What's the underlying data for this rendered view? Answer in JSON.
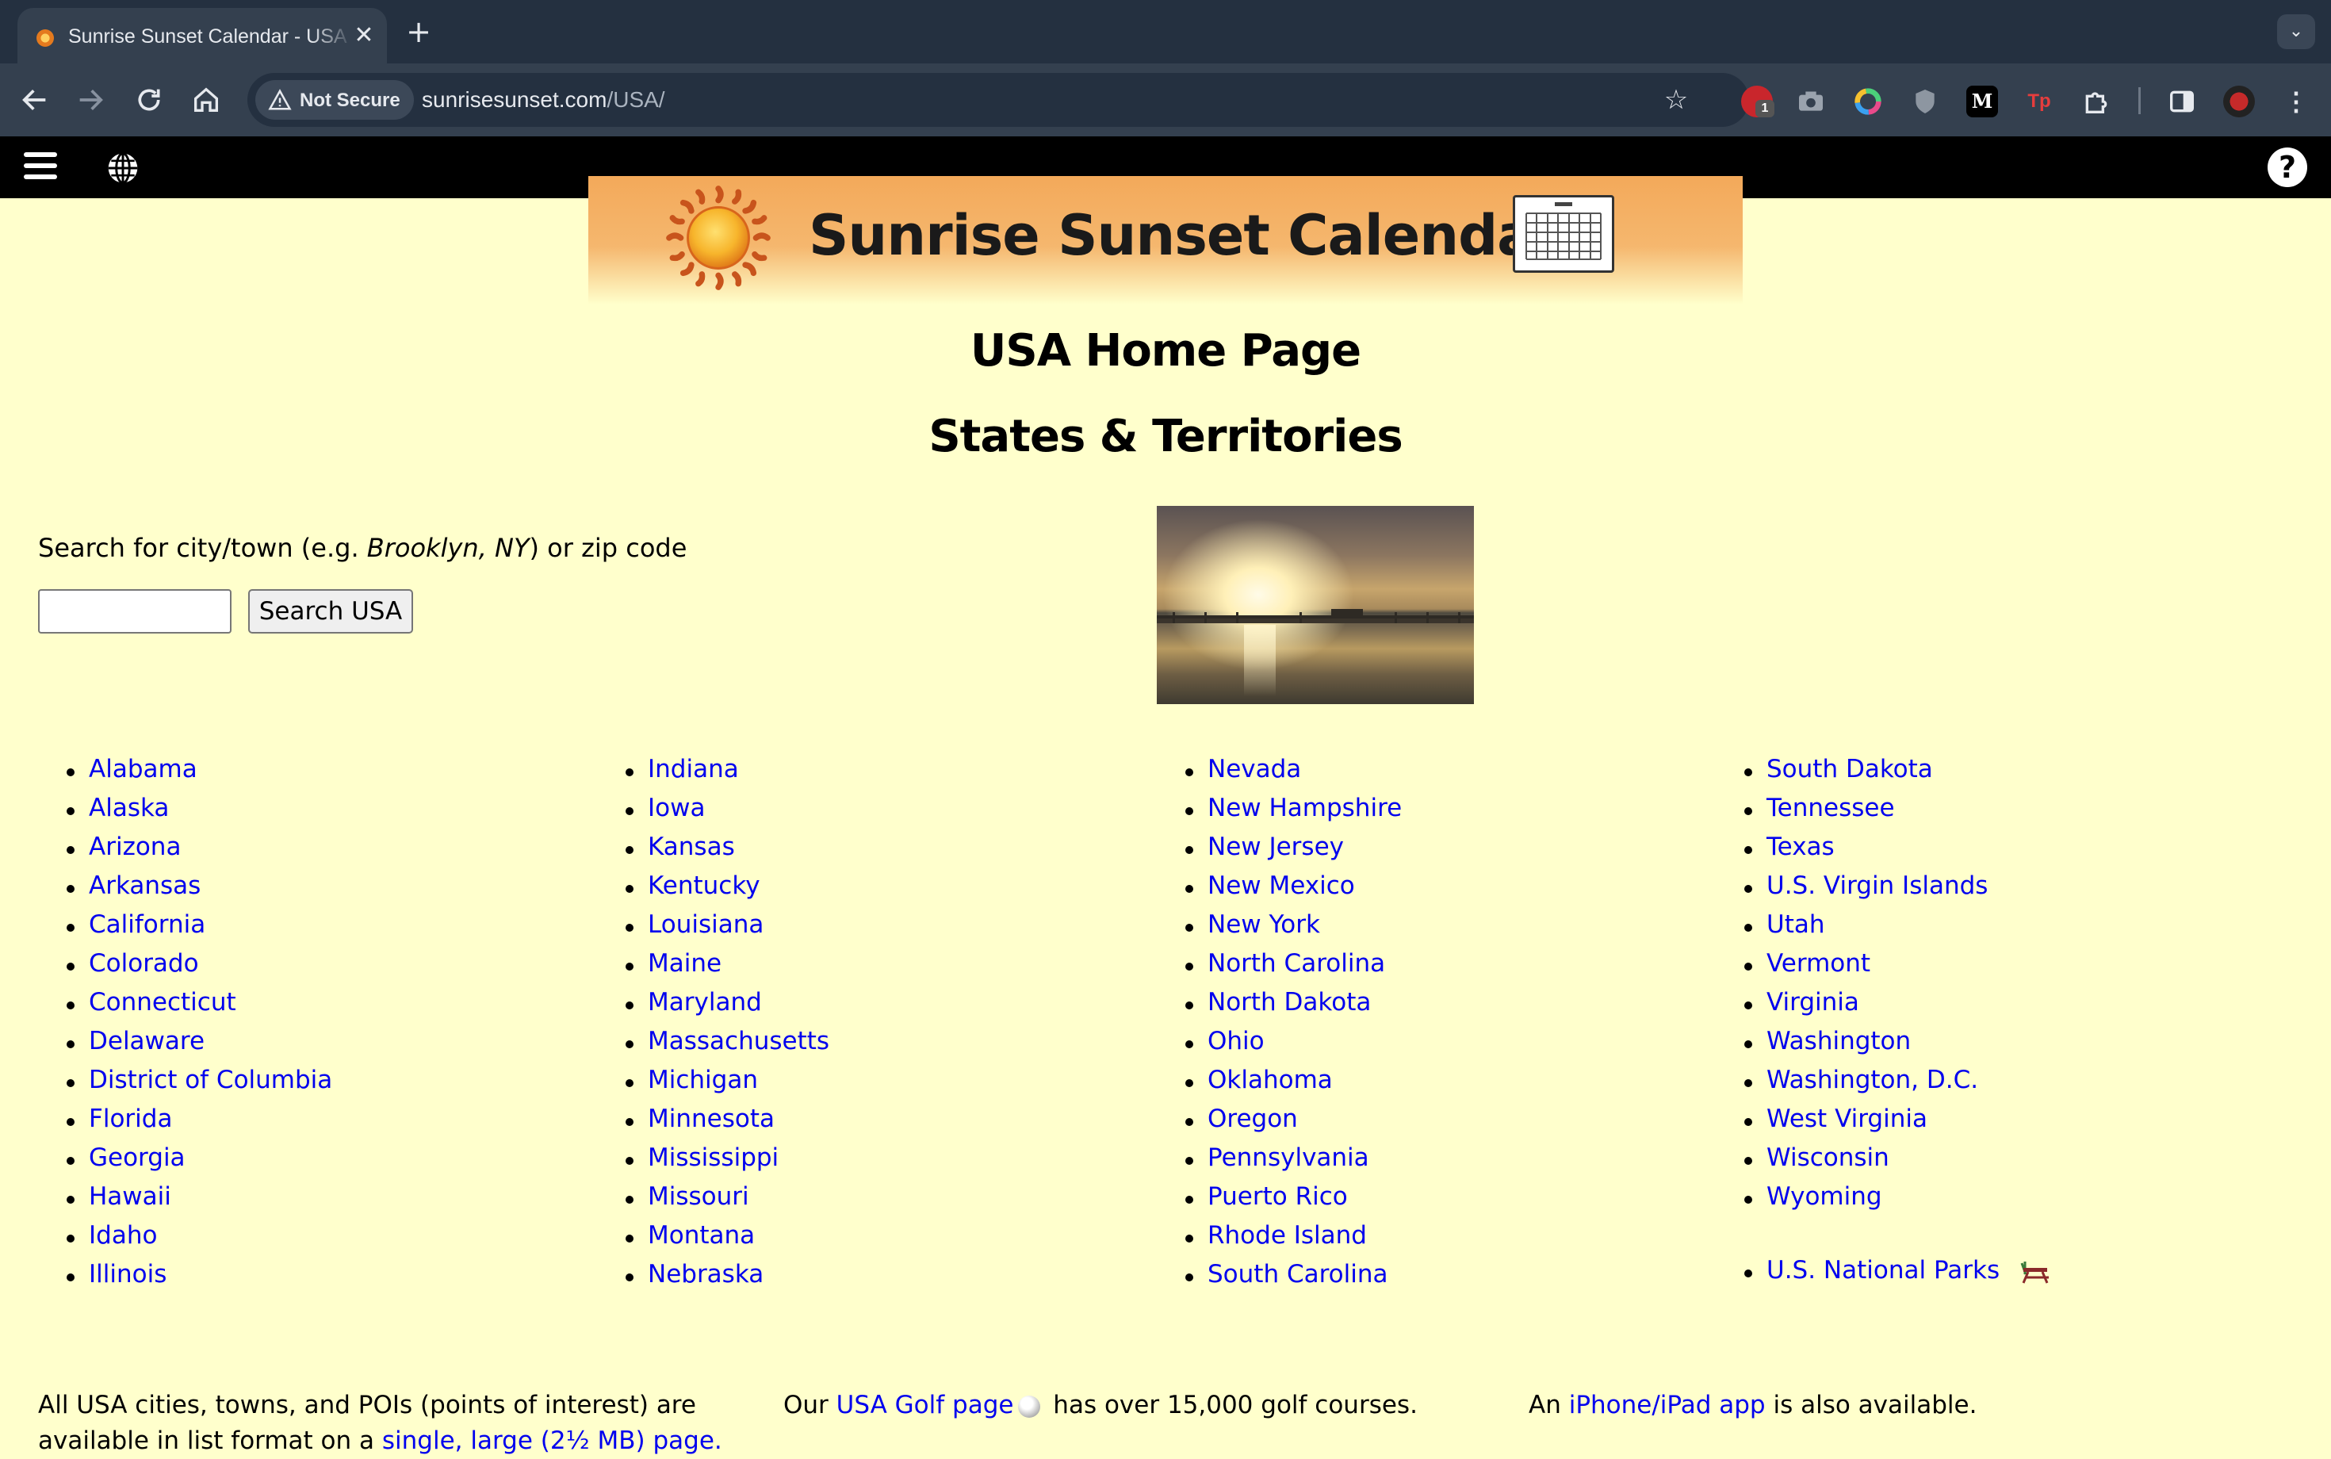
{
  "browser": {
    "tab_title": "Sunrise Sunset Calendar - USA",
    "tab_close": "✕",
    "new_tab": "+",
    "tab_menu": "⌄",
    "security_label": "Not Secure",
    "url_host": "sunrisesunset.com",
    "url_path": "/USA/",
    "extensions": [
      {
        "name": "adblock-icon",
        "glyph": "",
        "badge": "1"
      },
      {
        "name": "screenshot-icon",
        "glyph": ""
      },
      {
        "name": "color-icon",
        "glyph": ""
      },
      {
        "name": "shield-icon",
        "glyph": ""
      },
      {
        "name": "medium-icon",
        "glyph": "M"
      },
      {
        "name": "tp-icon",
        "glyph": "Tp"
      },
      {
        "name": "puzzle-icon",
        "glyph": ""
      }
    ]
  },
  "site_bar": {
    "help": "?"
  },
  "banner": {
    "title": "Sunrise Sunset Calendars"
  },
  "page": {
    "title": "USA Home Page",
    "subtitle": "States & Territories"
  },
  "search": {
    "label_prefix": "Search for city/town (e.g. ",
    "label_example": "Brooklyn, NY",
    "label_suffix": ") or zip code",
    "input_value": "",
    "button": "Search USA"
  },
  "states": {
    "col1": [
      "Alabama",
      "Alaska",
      "Arizona",
      "Arkansas",
      "California",
      "Colorado",
      "Connecticut",
      "Delaware",
      "District of Columbia",
      "Florida",
      "Georgia",
      "Hawaii",
      "Idaho",
      "Illinois"
    ],
    "col2": [
      "Indiana",
      "Iowa",
      "Kansas",
      "Kentucky",
      "Louisiana",
      "Maine",
      "Maryland",
      "Massachusetts",
      "Michigan",
      "Minnesota",
      "Mississippi",
      "Missouri",
      "Montana",
      "Nebraska"
    ],
    "col3": [
      "Nevada",
      "New Hampshire",
      "New Jersey",
      "New Mexico",
      "New York",
      "North Carolina",
      "North Dakota",
      "Ohio",
      "Oklahoma",
      "Oregon",
      "Pennsylvania",
      "Puerto Rico",
      "Rhode Island",
      "South Carolina"
    ],
    "col4": [
      "South Dakota",
      "Tennessee",
      "Texas",
      "U.S. Virgin Islands",
      "Utah",
      "Vermont",
      "Virginia",
      "Washington",
      "Washington, D.C.",
      "West Virginia",
      "Wisconsin",
      "Wyoming"
    ],
    "parks": "U.S. National Parks"
  },
  "footer": {
    "left_line1": "All USA cities, towns, and POIs (points of interest) are",
    "left_line2_prefix": "available in list format on a ",
    "left_link": "single, large (2½ MB) page.",
    "mid_prefix": "Our ",
    "mid_link": "USA Golf page",
    "mid_suffix": " has over 15,000 golf courses.",
    "right_prefix": "An ",
    "right_link": "iPhone/iPad app",
    "right_suffix": " is also available."
  },
  "colors": {
    "page_background": "#ffffcc",
    "link": "#0000ee",
    "banner_orange": "#f3a95a",
    "chrome_dark": "#243040"
  }
}
